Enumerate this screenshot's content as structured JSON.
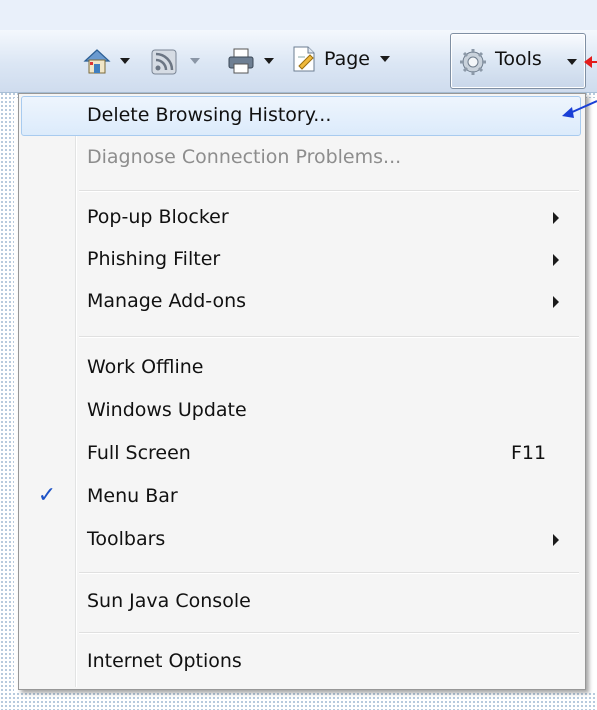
{
  "toolbar": {
    "page_label": "Page",
    "tools_label": "Tools"
  },
  "menu": {
    "items": [
      {
        "label": "Delete Browsing History..."
      },
      {
        "label": "Diagnose Connection Problems..."
      },
      {
        "label": "Pop-up Blocker"
      },
      {
        "label": "Phishing Filter"
      },
      {
        "label": "Manage Add-ons"
      },
      {
        "label": "Work Offline"
      },
      {
        "label": "Windows Update"
      },
      {
        "label": "Full Screen",
        "shortcut": "F11"
      },
      {
        "label": "Menu Bar",
        "checked": true
      },
      {
        "label": "Toolbars"
      },
      {
        "label": "Sun Java Console"
      },
      {
        "label": "Internet Options"
      }
    ]
  },
  "colors": {
    "highlight": "#dcebfb",
    "check": "#1d52c6",
    "annotation_red": "#e31b1b",
    "annotation_blue": "#1a3fd6"
  },
  "icons": [
    "home-icon",
    "feeds-icon",
    "print-icon",
    "page-icon",
    "gear-icon"
  ]
}
